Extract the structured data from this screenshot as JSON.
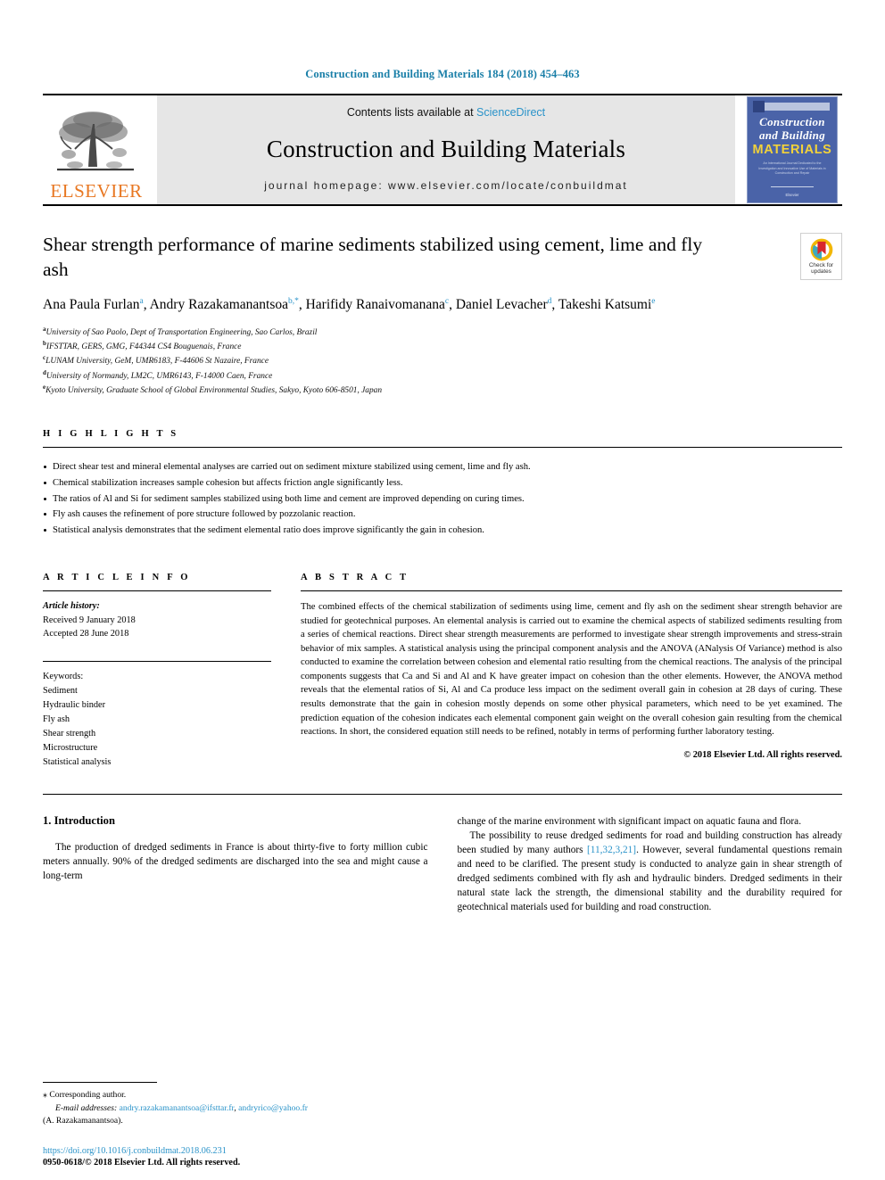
{
  "running_head": "Construction and Building Materials 184 (2018) 454–463",
  "masthead": {
    "publisher_name": "ELSEVIER",
    "contents_prefix": "Contents lists available at ",
    "sciencedirect": "ScienceDirect",
    "journal_title": "Construction and Building Materials",
    "homepage": "journal homepage: www.elsevier.com/locate/conbuildmat",
    "cover": {
      "line1": "Construction",
      "line2": "and Building",
      "line3": "MATERIALS",
      "blurb": "An International Journal Dedicated to the Investigation and Innovative Use of Materials in Construction and Repair",
      "footer": "Elsevier"
    }
  },
  "article": {
    "title": "Shear strength performance of marine sediments stabilized using cement, lime and fly ash",
    "authors": [
      {
        "name": "Ana Paula Furlan",
        "sup": "a",
        "sep": ", "
      },
      {
        "name": "Andry Razakamanantsoa",
        "sup": "b,*",
        "sep": ", "
      },
      {
        "name": "Harifidy Ranaivomanana",
        "sup": "c",
        "sep": ", "
      },
      {
        "name": "Daniel Levacher",
        "sup": "d",
        "sep": ", "
      },
      {
        "name": "Takeshi Katsumi",
        "sup": "e",
        "sep": ""
      }
    ],
    "affiliations": [
      {
        "label": "a",
        "text": "University of Sao Paolo, Dept of Transportation Engineering, Sao Carlos, Brazil"
      },
      {
        "label": "b",
        "text": "IFSTTAR, GERS, GMG, F44344 CS4 Bouguenais, France"
      },
      {
        "label": "c",
        "text": "LUNAM University, GeM, UMR6183, F-44606 St Nazaire, France"
      },
      {
        "label": "d",
        "text": "University of Normandy, LM2C, UMR6143, F-14000 Caen, France"
      },
      {
        "label": "e",
        "text": "Kyoto University, Graduate School of Global Environmental Studies, Sakyo, Kyoto 606-8501, Japan"
      }
    ],
    "crossmark": {
      "line1": "Check for",
      "line2": "updates"
    }
  },
  "highlights": {
    "heading": "H I G H L I G H T S",
    "items": [
      "Direct shear test and mineral elemental analyses are carried out on sediment mixture stabilized using cement, lime and fly ash.",
      "Chemical stabilization increases sample cohesion but affects friction angle significantly less.",
      "The ratios of Al and Si for sediment samples stabilized using both lime and cement are improved depending on curing times.",
      "Fly ash causes the refinement of pore structure followed by pozzolanic reaction.",
      "Statistical analysis demonstrates that the sediment elemental ratio does improve significantly the gain in cohesion."
    ]
  },
  "article_info": {
    "heading": "A R T I C L E  I N F O",
    "history_label": "Article history:",
    "received": "Received 9 January 2018",
    "accepted": "Accepted 28 June 2018",
    "keywords_label": "Keywords:",
    "keywords": [
      "Sediment",
      "Hydraulic binder",
      "Fly ash",
      "Shear strength",
      "Microstructure",
      "Statistical analysis"
    ]
  },
  "abstract": {
    "heading": "A B S T R A C T",
    "text": "The combined effects of the chemical stabilization of sediments using lime, cement and fly ash on the sediment shear strength behavior are studied for geotechnical purposes. An elemental analysis is carried out to examine the chemical aspects of stabilized sediments resulting from a series of chemical reactions. Direct shear strength measurements are performed to investigate shear strength improvements and stress-strain behavior of mix samples. A statistical analysis using the principal component analysis and the ANOVA (ANalysis Of Variance) method is also conducted to examine the correlation between cohesion and elemental ratio resulting from the chemical reactions. The analysis of the principal components suggests that Ca and Si and Al and K have greater impact on cohesion than the other elements. However, the ANOVA method reveals that the elemental ratios of Si, Al and Ca produce less impact on the sediment overall gain in cohesion at 28 days of curing. These results demonstrate that the gain in cohesion mostly depends on some other physical parameters, which need to be yet examined. The prediction equation of the cohesion indicates each elemental component gain weight on the overall cohesion gain resulting from the chemical reactions. In short, the considered equation still needs to be refined, notably in terms of performing further laboratory testing.",
    "copyright": "© 2018 Elsevier Ltd. All rights reserved."
  },
  "body": {
    "section_heading": "1. Introduction",
    "col_left_p1": "The production of dredged sediments in France is about thirty-five to forty million cubic meters annually. 90% of the dredged sediments are discharged into the sea and might cause a long-term",
    "col_right_p1": "change of the marine environment with significant impact on aquatic fauna and flora.",
    "col_right_p2_a": "The possibility to reuse dredged sediments for road and building construction has already been studied by many authors ",
    "col_right_citation": "[11,32,3,21]",
    "col_right_p2_b": ". However, several fundamental questions remain and need to be clarified. The present study is conducted to analyze gain in shear strength of dredged sediments combined with fly ash and hydraulic binders. Dredged sediments in their natural state lack the strength, the dimensional stability and the durability required for geotechnical materials used for building and road construction."
  },
  "footnote": {
    "corresponding": "Corresponding author.",
    "email_label": "E-mail addresses:",
    "email1": "andry.razakamanantsoa@ifsttar.fr",
    "email_sep": ", ",
    "email2": "andryrico@yahoo.fr",
    "email_owner": "(A. Razakamanantsoa)."
  },
  "doi": {
    "url": "https://doi.org/10.1016/j.conbuildmat.2018.06.231",
    "issn_line": "0950-0618/© 2018 Elsevier Ltd. All rights reserved."
  },
  "colors": {
    "link_blue": "#2a93c9",
    "header_blue": "#1a7fa8",
    "elsevier_orange": "#E87722",
    "cover_blue": "#4a63a8",
    "cover_yellow": "#f2d23a"
  }
}
